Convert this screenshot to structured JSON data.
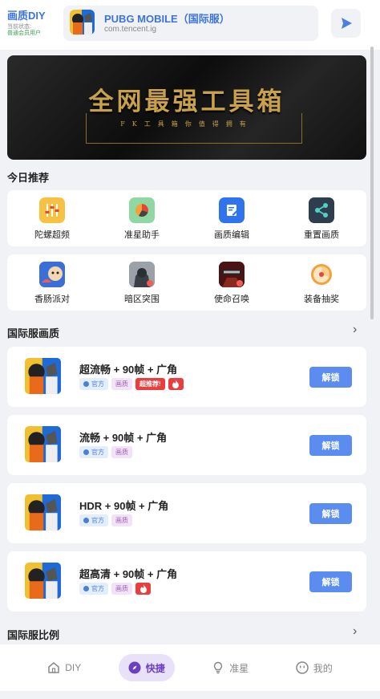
{
  "header": {
    "brand_title": "画质DIY",
    "status_label": "当前状态:",
    "member_label": "普通会员用户",
    "game_name": "PUBG MOBILE（国际服）",
    "game_package": "com.tencent.ig",
    "play_icon": "play-triangle-icon"
  },
  "banner": {
    "title": "全网最强工具箱",
    "subtitle": "FK工具箱你值得拥有"
  },
  "today": {
    "title": "今日推荐",
    "row1": [
      {
        "label": "陀螺超频",
        "icon": "sliders-icon",
        "color": "#f7c244"
      },
      {
        "label": "准星助手",
        "icon": "pie-chart-icon",
        "color": "#8fd8a4"
      },
      {
        "label": "画质编辑",
        "icon": "edit-document-icon",
        "color": "#2f73ee"
      },
      {
        "label": "重置画质",
        "icon": "share-icon",
        "color": "#2e3e4e"
      }
    ],
    "row2": [
      {
        "label": "香肠派对",
        "icon": "sausage-party-game-icon",
        "color": "#3b6fd8"
      },
      {
        "label": "暗区突围",
        "icon": "arena-breakout-game-icon",
        "color": "#7a7f86"
      },
      {
        "label": "使命召唤",
        "icon": "call-of-duty-game-icon",
        "color": "#6b1e1e"
      },
      {
        "label": "装备抽奖",
        "icon": "prize-wheel-icon",
        "color": "#f3a23a"
      }
    ]
  },
  "intl_quality": {
    "title": "国际服画质",
    "chevron": "›",
    "items": [
      {
        "title": "超流畅 + 90帧 + 广角",
        "tags": [
          "官方",
          "画质"
        ],
        "recommend": "超推荐!",
        "hot": true,
        "button": "解锁"
      },
      {
        "title": "流畅 + 90帧 + 广角",
        "tags": [
          "官方",
          "画质"
        ],
        "recommend": "",
        "hot": false,
        "button": "解锁"
      },
      {
        "title": "HDR + 90帧 + 广角",
        "tags": [
          "官方",
          "画质"
        ],
        "recommend": "",
        "hot": false,
        "button": "解锁"
      },
      {
        "title": "超高清 + 90帧 + 广角",
        "tags": [
          "官方",
          "画质"
        ],
        "recommend": "",
        "hot": true,
        "button": "解锁"
      }
    ]
  },
  "intl_ratio": {
    "title": "国际服比例",
    "chevron": "›"
  },
  "tabbar": {
    "tabs": [
      {
        "label": "DIY",
        "icon": "home-icon",
        "active": false
      },
      {
        "label": "快捷",
        "icon": "compass-icon",
        "active": true
      },
      {
        "label": "准星",
        "icon": "lightbulb-icon",
        "active": false
      },
      {
        "label": "我的",
        "icon": "smiley-face-icon",
        "active": false
      }
    ]
  },
  "colors": {
    "accent": "#3b74e0",
    "unlock_button": "#5b8cf0",
    "active_tab_bg": "#e9e1f7",
    "active_tab_text": "#6a3fc4",
    "hot_red": "#ea3e3e"
  }
}
